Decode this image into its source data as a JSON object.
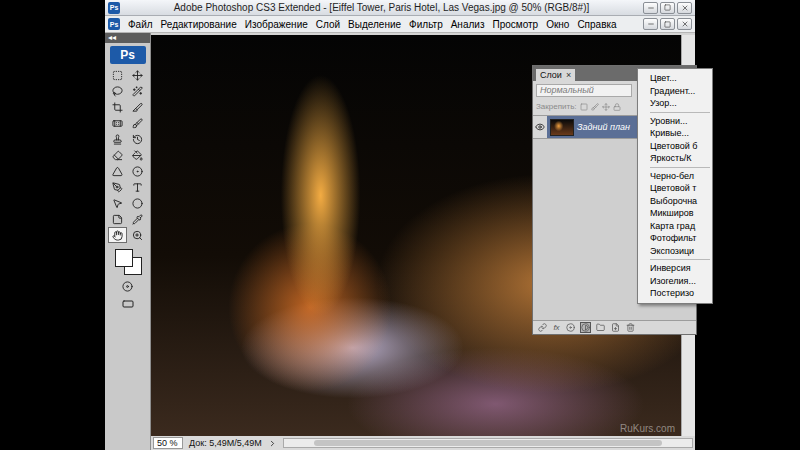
{
  "window": {
    "title": "Adobe Photoshop CS3 Extended - [Eiffel Tower, Paris Hotel, Las Vegas.jpg @ 50% (RGB/8#)]",
    "logo": "Ps"
  },
  "menu_bar": [
    "Файл",
    "Редактирование",
    "Изображение",
    "Слой",
    "Выделение",
    "Фильтр",
    "Анализ",
    "Просмотр",
    "Окно",
    "Справка"
  ],
  "toolbox": {
    "collapse": "◂◂",
    "tools": [
      {
        "selected": false
      },
      {
        "selected": false
      },
      {
        "selected": false
      },
      {
        "selected": false
      },
      {
        "selected": false
      },
      {
        "selected": false
      },
      {
        "selected": false
      },
      {
        "selected": false
      },
      {
        "selected": false
      },
      {
        "selected": false
      },
      {
        "selected": false
      },
      {
        "selected": false
      },
      {
        "selected": false
      },
      {
        "selected": false
      },
      {
        "selected": false
      },
      {
        "selected": false
      },
      {
        "selected": false
      },
      {
        "selected": false
      },
      {
        "selected": false
      },
      {
        "selected": false
      },
      {
        "selected": true
      },
      {
        "selected": false
      }
    ]
  },
  "document": {
    "zoom": "50 %",
    "doc_info": "Док: 5,49М/5,49М",
    "watermark": "RuKurs.com"
  },
  "layers_panel": {
    "tab": "Слои",
    "close": "×",
    "blend_mode": "Нормальный",
    "lock_label": "Закрепить:",
    "layers": [
      {
        "name": "Задний план",
        "visible": true,
        "selected": true,
        "locked": true
      }
    ],
    "footer_buttons": [
      {
        "kind": "link",
        "label": "",
        "active": false
      },
      {
        "kind": "fx",
        "label": "fx",
        "active": false
      },
      {
        "kind": "mask",
        "label": "",
        "active": false
      },
      {
        "kind": "adjustment",
        "label": "",
        "active": true
      },
      {
        "kind": "group",
        "label": "",
        "active": false
      },
      {
        "kind": "new",
        "label": "",
        "active": false
      },
      {
        "kind": "delete",
        "label": "",
        "active": false
      }
    ]
  },
  "adjustment_menu": {
    "items": [
      {
        "kind": "item",
        "label": "Цвет..."
      },
      {
        "kind": "item",
        "label": "Градиент..."
      },
      {
        "kind": "item",
        "label": "Узор..."
      },
      {
        "kind": "separator",
        "label": ""
      },
      {
        "kind": "item",
        "label": "Уровни..."
      },
      {
        "kind": "item",
        "label": "Кривые..."
      },
      {
        "kind": "item",
        "label": "Цветовой б"
      },
      {
        "kind": "item",
        "label": "Яркость/К"
      },
      {
        "kind": "separator",
        "label": ""
      },
      {
        "kind": "item",
        "label": "Черно-бел"
      },
      {
        "kind": "item",
        "label": "Цветовой т"
      },
      {
        "kind": "item",
        "label": "Выборочна"
      },
      {
        "kind": "item",
        "label": "Микширов"
      },
      {
        "kind": "item",
        "label": "Карта град"
      },
      {
        "kind": "item",
        "label": "Фотофильт"
      },
      {
        "kind": "item",
        "label": "Экспозици"
      },
      {
        "kind": "separator",
        "label": ""
      },
      {
        "kind": "item",
        "label": "Инверсия"
      },
      {
        "kind": "item",
        "label": "Изогелия..."
      },
      {
        "kind": "item",
        "label": "Постеризо"
      }
    ]
  }
}
